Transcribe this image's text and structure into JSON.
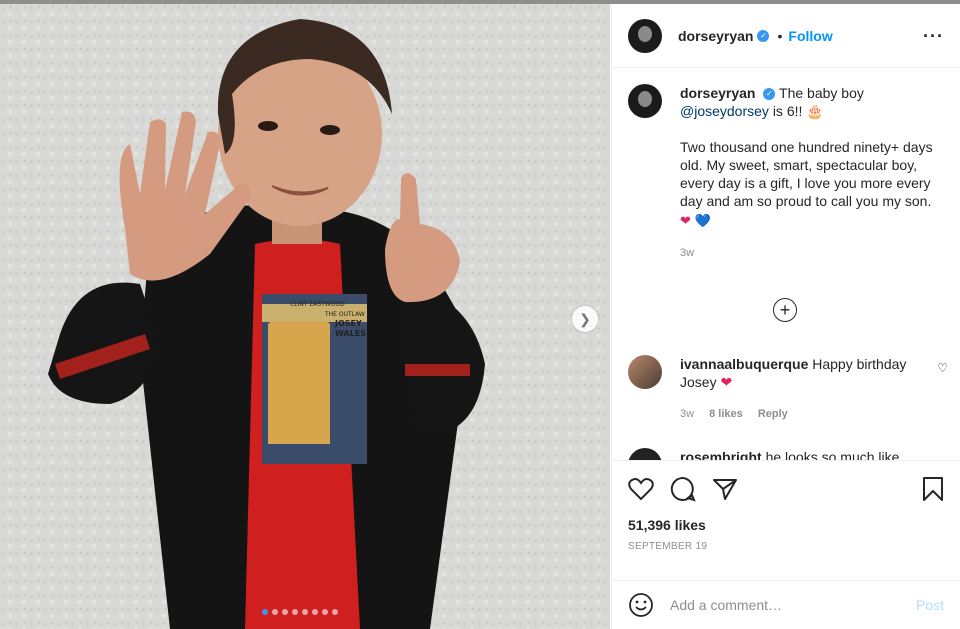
{
  "post": {
    "username": "dorseyryan",
    "follow_label": "Follow",
    "bullet": "•",
    "more_icon": "more-options-icon",
    "caption": {
      "username": "dorseyryan",
      "text_before": "The baby boy",
      "mention": "@joseydorsey",
      "text_after": "is 6!! 🎂",
      "paragraph": "Two thousand one hundred ninety+ days old. My sweet, smart, spectacular boy, every day is a gift, I love you more every day and am so proud to call you my son.",
      "hearts": [
        "❤",
        "💙"
      ],
      "time": "3w"
    },
    "load_more_icon": "plus-circle-icon",
    "comments": [
      {
        "username": "ivannaalbuquerque",
        "text": "Happy birthday Josey",
        "emoji": "❤",
        "time": "3w",
        "likes": "8 likes",
        "reply": "Reply"
      },
      {
        "username": "rosembright",
        "text": "he looks so much like"
      }
    ],
    "likes_count": "51,396 likes",
    "date": "SEPTEMBER 19",
    "add_comment_placeholder": "Add a comment…",
    "post_label": "Post",
    "carousel_count": 8,
    "carousel_active_index": 0
  },
  "photo": {
    "shirt_text": [
      "CLINT EASTWOOD",
      "THE OUTLAW",
      "JOSEY",
      "WALES"
    ]
  },
  "colors": {
    "accent": "#0095f6",
    "verified": "#3897f0",
    "muted": "#8e8e8e"
  }
}
